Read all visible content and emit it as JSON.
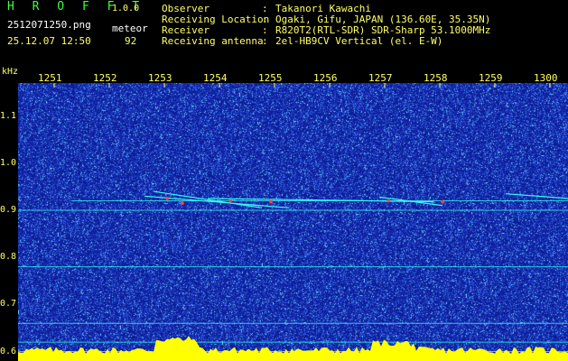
{
  "header": {
    "app_name": "H R O F F T",
    "version": "1.0.0",
    "filename": "2512071250.png",
    "meteor_label": "meteor",
    "timestamp": "25.12.07 12:50",
    "meteor_count": "92",
    "info": [
      {
        "label": "Observer",
        "value": "Takanori Kawachi"
      },
      {
        "label": "Receiving Location",
        "value": "Ogaki, Gifu, JAPAN (136.60E, 35.35N)"
      },
      {
        "label": "Receiver",
        "value": "R820T2(RTL-SDR) SDR-Sharp 53.1000MHz"
      },
      {
        "label": "Receiving antenna",
        "value": "2el-HB9CV Vertical (el. E-W)"
      }
    ]
  },
  "y_unit": "kHz",
  "colors": {
    "background": "#000000",
    "plot_noise": "#0e1f9a",
    "trace": "#33ffee",
    "amplitude": "#ffff00",
    "text_green": "#3cff3c",
    "text_yellow": "#ffff66"
  },
  "chart_data": {
    "type": "heatmap",
    "x_ticks": [
      "1251",
      "1252",
      "1253",
      "1254",
      "1255",
      "1256",
      "1257",
      "1258",
      "1259",
      "1300"
    ],
    "y_ticks": [
      "1.1",
      "1.0",
      "0.9",
      "0.8",
      "0.7",
      "0.6"
    ],
    "y_range": [
      0.58,
      1.17
    ],
    "x_range_minutes": [
      0,
      10
    ],
    "carrier_lines_khz": [
      0.92,
      0.9,
      0.78,
      0.66,
      0.62,
      0.6
    ]
  }
}
